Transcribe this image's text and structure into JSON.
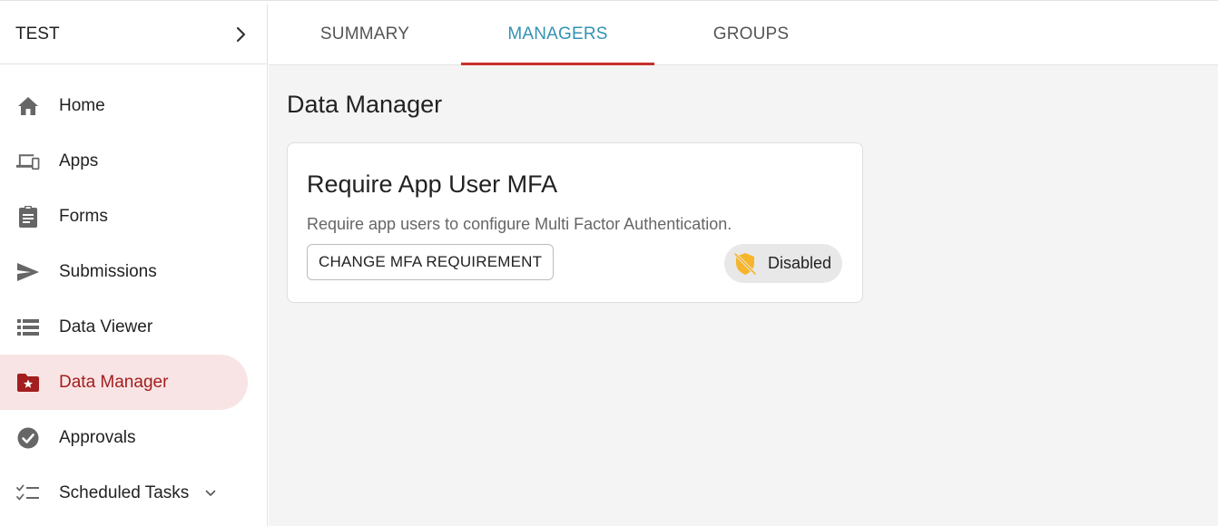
{
  "workspace": {
    "name": "TEST",
    "icon": "chevron-right-icon"
  },
  "sidebar": {
    "items": [
      {
        "label": "Home",
        "icon": "home-icon"
      },
      {
        "label": "Apps",
        "icon": "devices-icon"
      },
      {
        "label": "Forms",
        "icon": "clipboard-icon"
      },
      {
        "label": "Submissions",
        "icon": "send-icon"
      },
      {
        "label": "Data Viewer",
        "icon": "list-icon"
      },
      {
        "label": "Data Manager",
        "icon": "folder-star-icon",
        "active": true
      },
      {
        "label": "Approvals",
        "icon": "check-circle-icon"
      },
      {
        "label": "Scheduled Tasks",
        "icon": "checklist-icon",
        "expand_icon": "chevron-down-icon"
      }
    ]
  },
  "tabs": [
    {
      "label": "SUMMARY"
    },
    {
      "label": "MANAGERS",
      "active": true
    },
    {
      "label": "GROUPS"
    }
  ],
  "page": {
    "title": "Data Manager"
  },
  "card": {
    "title": "Require App User MFA",
    "description": "Require app users to configure Multi Factor Authentication.",
    "button_label": "CHANGE MFA REQUIREMENT",
    "status": {
      "label": "Disabled",
      "icon": "shield-off-icon",
      "color": "#f7b52c"
    }
  },
  "colors": {
    "active_nav_bg": "#f8e4e4",
    "active_nav_text": "#a31e1e",
    "active_tab_text": "#3492b4",
    "active_tab_underline": "#c8312b",
    "main_bg": "#f4f4f4"
  }
}
